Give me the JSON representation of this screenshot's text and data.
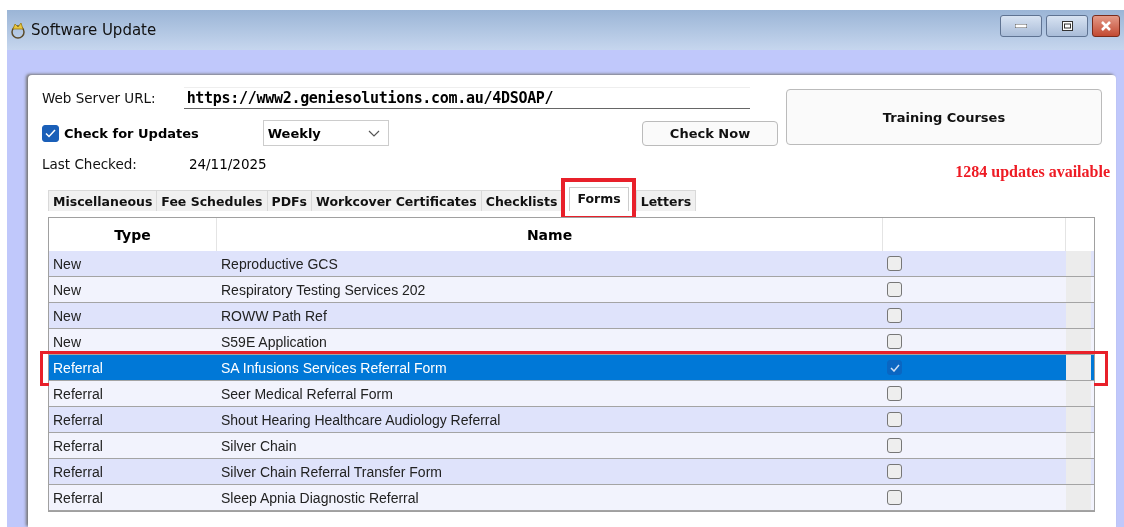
{
  "window": {
    "title": "Software Update"
  },
  "web_server_url": {
    "label": "Web Server URL:",
    "value": "https://www2.geniesolutions.com.au/4DSOAP/"
  },
  "check_for_updates": {
    "label": "Check for Updates",
    "checked": true
  },
  "frequency": {
    "value": "Weekly"
  },
  "check_now_button": "Check Now",
  "training_courses_button": "Training Courses",
  "last_checked": {
    "label": "Last Checked:",
    "value": "24/11/2025"
  },
  "updates_available": "1284 updates available",
  "tabs": [
    {
      "label": "Miscellaneous",
      "selected": false,
      "highlighted": false
    },
    {
      "label": "Fee Schedules",
      "selected": false,
      "highlighted": false
    },
    {
      "label": "PDFs",
      "selected": false,
      "highlighted": false
    },
    {
      "label": "Workcover Certificates",
      "selected": false,
      "highlighted": false
    },
    {
      "label": "Checklists",
      "selected": false,
      "highlighted": false
    },
    {
      "label": "Forms",
      "selected": true,
      "highlighted": true
    },
    {
      "label": "Letters",
      "selected": false,
      "highlighted": false
    }
  ],
  "table": {
    "columns": [
      "Type",
      "Name"
    ],
    "rows": [
      {
        "type": "New",
        "name": "Reproductive GCS",
        "checked": false,
        "selected": false,
        "highlighted": false
      },
      {
        "type": "New",
        "name": "Respiratory Testing Services 202",
        "checked": false,
        "selected": false,
        "highlighted": false
      },
      {
        "type": "New",
        "name": "ROWW Path Ref",
        "checked": false,
        "selected": false,
        "highlighted": false
      },
      {
        "type": "New",
        "name": "S59E Application",
        "checked": false,
        "selected": false,
        "highlighted": false
      },
      {
        "type": "Referral",
        "name": "SA Infusions Services Referral Form",
        "checked": true,
        "selected": true,
        "highlighted": true
      },
      {
        "type": "Referral",
        "name": "Seer Medical Referral Form",
        "checked": false,
        "selected": false,
        "highlighted": false
      },
      {
        "type": "Referral",
        "name": "Shout Hearing Healthcare Audiology Referral",
        "checked": false,
        "selected": false,
        "highlighted": false
      },
      {
        "type": "Referral",
        "name": "Silver Chain",
        "checked": false,
        "selected": false,
        "highlighted": false
      },
      {
        "type": "Referral",
        "name": "Silver Chain Referral Transfer Form",
        "checked": false,
        "selected": false,
        "highlighted": false
      },
      {
        "type": "Referral",
        "name": "Sleep Apnia Diagnostic Referral",
        "checked": false,
        "selected": false,
        "highlighted": false
      }
    ]
  }
}
